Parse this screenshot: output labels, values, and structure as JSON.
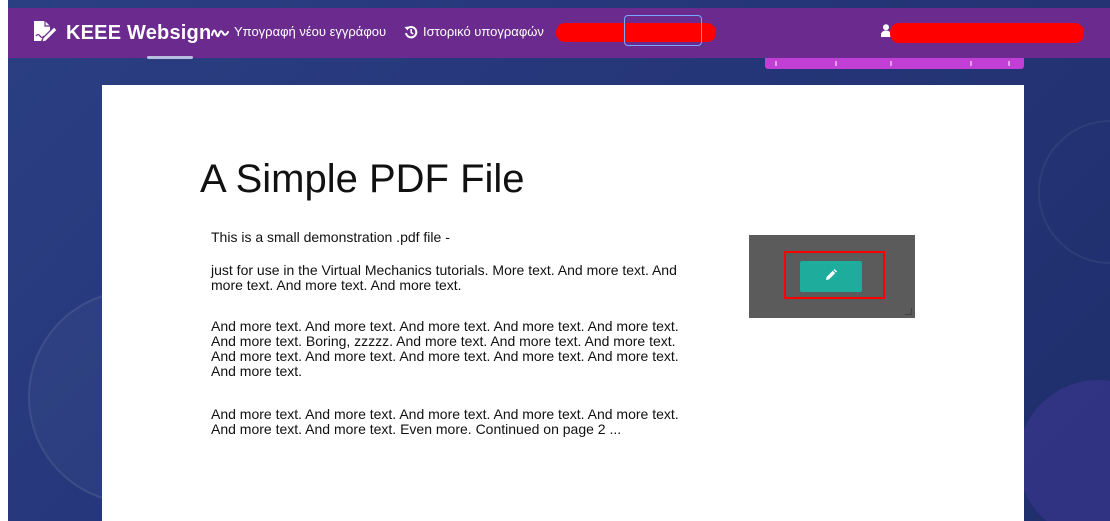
{
  "navbar": {
    "brand": "KEEE Websign",
    "links": [
      {
        "label": "Υπογραφή νέου εγγράφου",
        "icon": "signature-icon"
      },
      {
        "label": "Ιστορικό υπογραφών",
        "icon": "history-icon"
      }
    ],
    "user_icon": "user-icon",
    "colors": {
      "navbar": "#6b2a8e",
      "redaction": "#ff0000"
    }
  },
  "document": {
    "title": "A Simple PDF File",
    "paragraphs": [
      "This is a small demonstration .pdf file -",
      "just for use in the Virtual Mechanics tutorials. More text. And more text. And more text. And more text. And more text.",
      "And more text. And more text. And more text. And more text. And more text. And more text. Boring, zzzzz. And more text. And more text. And more text. And more text. And more text. And more text. And more text. And more text. And more text.",
      "And more text. And more text. And more text. And more text. And more text. And more text. And more text. Even more. Continued on page 2 ..."
    ]
  },
  "signature_field": {
    "button_icon": "pencil-icon",
    "colors": {
      "button": "#1eac9c",
      "box": "#5b5b5b",
      "highlight": "#ff0000"
    }
  }
}
